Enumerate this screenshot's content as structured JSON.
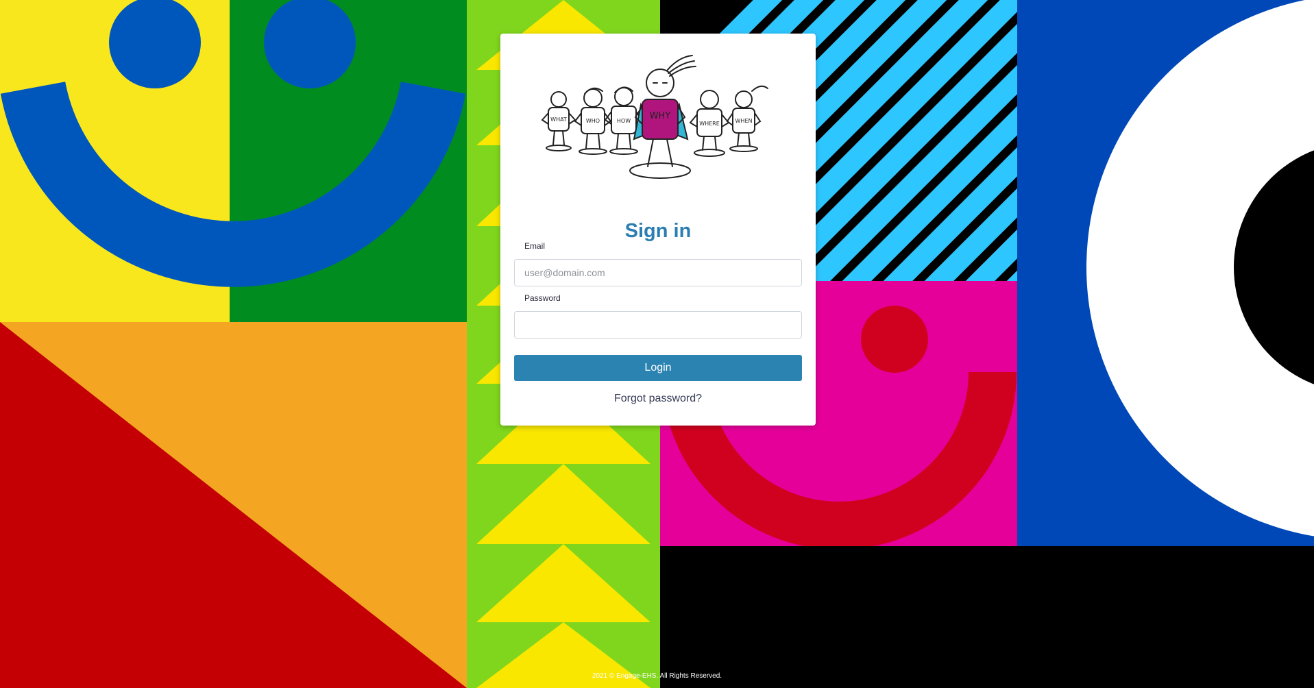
{
  "login": {
    "title": "Sign in",
    "email_label": "Email",
    "email_placeholder": "user@domain.com",
    "email_value": "",
    "password_label": "Password",
    "password_value": "",
    "login_button": "Login",
    "forgot_password": "Forgot password?"
  },
  "illustration": {
    "figures": [
      "WHAT",
      "WHO",
      "HOW",
      "WHY",
      "WHERE",
      "WHEN"
    ]
  },
  "footer": {
    "text": "2021 © Engage-EHS. All Rights Reserved."
  },
  "colors": {
    "title": "#2b7eb1",
    "button": "#2a83b1",
    "hero_shirt": "#b0157e",
    "cape": "#34b6d6"
  }
}
